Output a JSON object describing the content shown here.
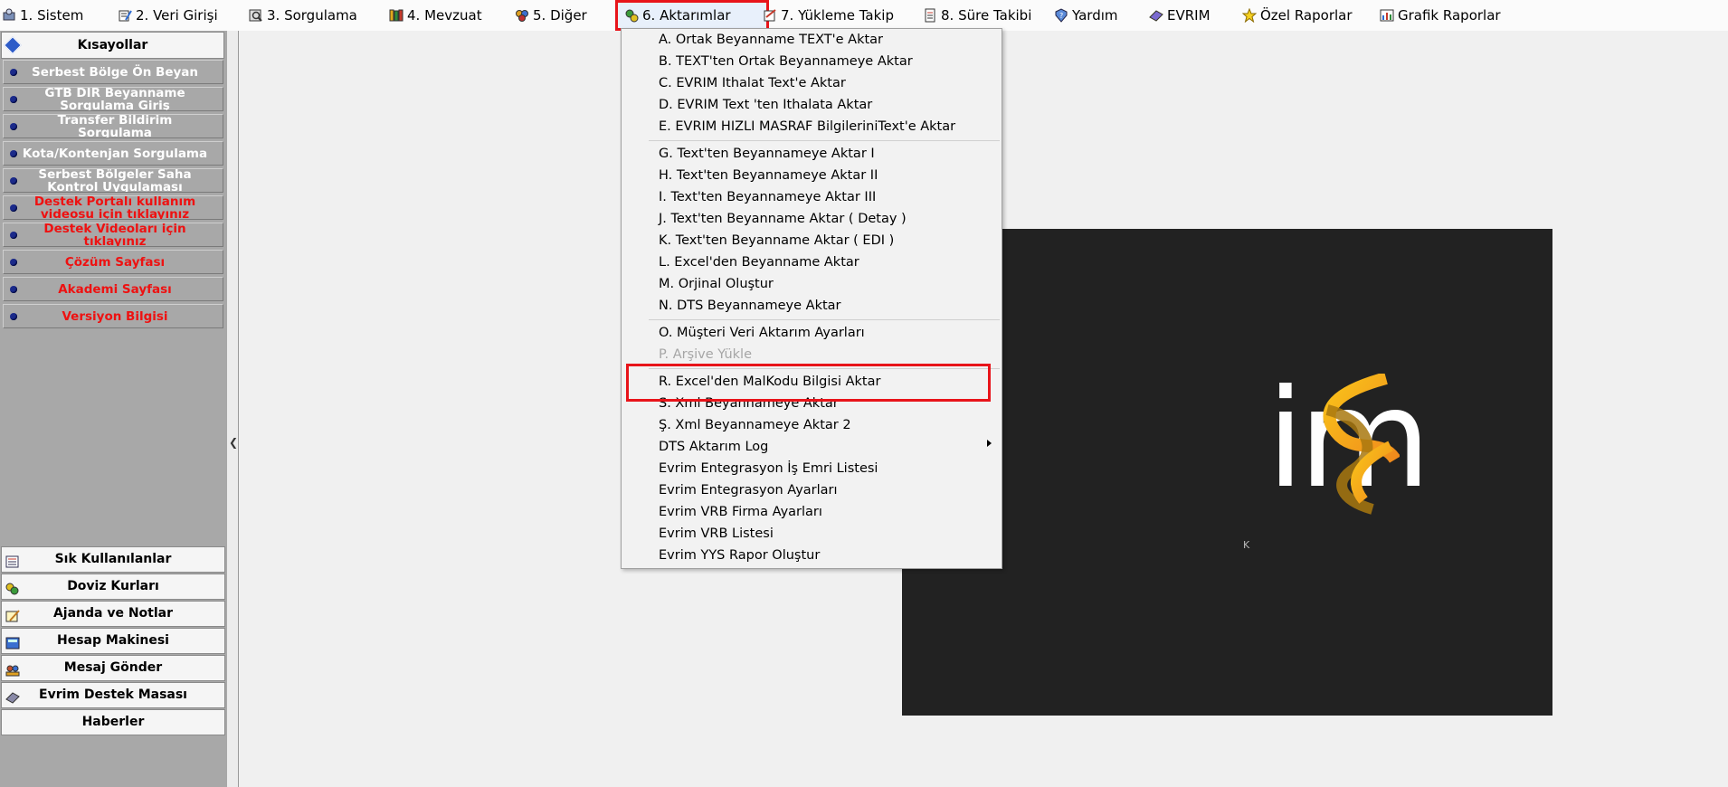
{
  "menubar": {
    "items": [
      {
        "label": "1.  Sistem",
        "icon": "system-icon"
      },
      {
        "label": "2.  Veri Girişi",
        "icon": "data-entry-icon"
      },
      {
        "label": "3.  Sorgulama",
        "icon": "query-icon"
      },
      {
        "label": "4.  Mevzuat",
        "icon": "books-icon"
      },
      {
        "label": "5.  Diğer",
        "icon": "other-icon"
      },
      {
        "label": "6.  Aktarımlar",
        "icon": "transfer-icon"
      },
      {
        "label": "7.  Yükleme Takip",
        "icon": "upload-tracking-icon"
      },
      {
        "label": "8. Süre Takibi",
        "icon": "duration-icon"
      },
      {
        "label": "Yardım",
        "icon": "help-icon"
      },
      {
        "label": "EVRIM",
        "icon": "evrim-icon"
      },
      {
        "label": "Özel Raporlar",
        "icon": "star-icon"
      },
      {
        "label": "Grafik Raporlar",
        "icon": "chart-icon"
      }
    ]
  },
  "shortcuts": {
    "title": "Kısayollar",
    "items": [
      {
        "label": "Serbest Bölge Ön Beyan",
        "color": "white"
      },
      {
        "label": "GTB DIR Beyanname Sorgulama Giriş",
        "color": "white"
      },
      {
        "label": "Transfer Bildirim Sorgulama",
        "color": "white"
      },
      {
        "label": "Kota/Kontenjan Sorgulama",
        "color": "white"
      },
      {
        "label": "Serbest Bölgeler Saha Kontrol Uygulaması",
        "color": "white"
      },
      {
        "label": "Destek Portalı kullanım videosu için tıklayınız",
        "color": "red"
      },
      {
        "label": "Destek Videoları için tıklayınız",
        "color": "red"
      },
      {
        "label": "Çözüm Sayfası",
        "color": "red"
      },
      {
        "label": "Akademi Sayfası",
        "color": "red"
      },
      {
        "label": "Versiyon Bilgisi",
        "color": "red"
      }
    ]
  },
  "bottom_panel": {
    "items": [
      {
        "label": "Sık Kullanılanlar",
        "icon": "favorites-icon"
      },
      {
        "label": "Doviz Kurları",
        "icon": "currency-icon"
      },
      {
        "label": "Ajanda ve Notlar",
        "icon": "agenda-icon"
      },
      {
        "label": "Hesap Makinesi",
        "icon": "calculator-icon"
      },
      {
        "label": "Mesaj Gönder",
        "icon": "message-icon"
      },
      {
        "label": "Evrim Destek Masası",
        "icon": "support-icon"
      },
      {
        "label": "Haberler",
        "icon": ""
      }
    ]
  },
  "dropdown": {
    "items": [
      {
        "label": "A.   Ortak Beyanname TEXT'e Aktar",
        "disabled": false
      },
      {
        "label": "B.   TEXT'ten Ortak Beyannameye Aktar",
        "disabled": false
      },
      {
        "label": "C.   EVRIM Ithalat Text'e Aktar",
        "disabled": false
      },
      {
        "label": "D.   EVRIM Text 'ten Ithalata Aktar",
        "disabled": false
      },
      {
        "label": "E.   EVRIM  HIZLI MASRAF BilgileriniText'e Aktar",
        "disabled": false
      },
      {
        "label": "G.  Text'ten Beyannameye Aktar I",
        "disabled": false
      },
      {
        "label": "H.  Text'ten Beyannameye Aktar II",
        "disabled": false
      },
      {
        "label": "I.  Text'ten Beyannameye Aktar III",
        "disabled": false
      },
      {
        "label": "J.   Text'ten Beyanname Aktar ( Detay )",
        "disabled": false
      },
      {
        "label": "K.   Text'ten Beyanname Aktar ( EDI )",
        "disabled": false
      },
      {
        "label": "L.   Excel'den Beyanname Aktar",
        "disabled": false
      },
      {
        "label": "M.   Orjinal Oluştur",
        "disabled": false
      },
      {
        "label": "N.   DTS Beyannameye Aktar",
        "disabled": false
      },
      {
        "label": "O.  Müşteri Veri Aktarım Ayarları",
        "disabled": false
      },
      {
        "label": "P.  Arşive Yükle",
        "disabled": true
      },
      {
        "label": "R.   Excel'den MalKodu Bilgisi Aktar",
        "disabled": false
      },
      {
        "label": "S.  Xml Beyannameye Aktar",
        "disabled": false
      },
      {
        "label": "Ş.  Xml Beyannameye Aktar 2",
        "disabled": false
      },
      {
        "label": "DTS Aktarım Log",
        "disabled": false
      },
      {
        "label": "Evrim Entegrasyon İş Emri Listesi",
        "disabled": false
      },
      {
        "label": "Evrim Entegrasyon Ayarları",
        "disabled": false
      },
      {
        "label": "Evrim VRB Firma Ayarları",
        "disabled": false
      },
      {
        "label": "Evrim VRB Listesi",
        "disabled": false
      },
      {
        "label": "Evrim YYS Rapor Oluştur",
        "disabled": false
      }
    ]
  },
  "logo": {
    "text": "im",
    "tagline": "K"
  },
  "colors": {
    "highlight": "#e8141a",
    "logo_background": "#222222",
    "logo_gradient_start": "#f9c31a",
    "logo_gradient_end": "#f08a1c",
    "shortcut_red": "#ee1111"
  }
}
